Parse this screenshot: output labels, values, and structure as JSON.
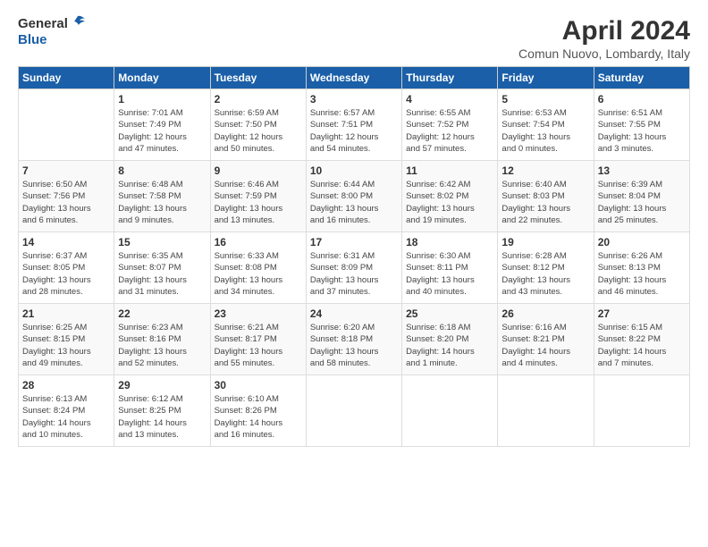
{
  "header": {
    "logo_general": "General",
    "logo_blue": "Blue",
    "title": "April 2024",
    "subtitle": "Comun Nuovo, Lombardy, Italy"
  },
  "days_of_week": [
    "Sunday",
    "Monday",
    "Tuesday",
    "Wednesday",
    "Thursday",
    "Friday",
    "Saturday"
  ],
  "weeks": [
    [
      {
        "day": "",
        "info": ""
      },
      {
        "day": "1",
        "info": "Sunrise: 7:01 AM\nSunset: 7:49 PM\nDaylight: 12 hours\nand 47 minutes."
      },
      {
        "day": "2",
        "info": "Sunrise: 6:59 AM\nSunset: 7:50 PM\nDaylight: 12 hours\nand 50 minutes."
      },
      {
        "day": "3",
        "info": "Sunrise: 6:57 AM\nSunset: 7:51 PM\nDaylight: 12 hours\nand 54 minutes."
      },
      {
        "day": "4",
        "info": "Sunrise: 6:55 AM\nSunset: 7:52 PM\nDaylight: 12 hours\nand 57 minutes."
      },
      {
        "day": "5",
        "info": "Sunrise: 6:53 AM\nSunset: 7:54 PM\nDaylight: 13 hours\nand 0 minutes."
      },
      {
        "day": "6",
        "info": "Sunrise: 6:51 AM\nSunset: 7:55 PM\nDaylight: 13 hours\nand 3 minutes."
      }
    ],
    [
      {
        "day": "7",
        "info": "Sunrise: 6:50 AM\nSunset: 7:56 PM\nDaylight: 13 hours\nand 6 minutes."
      },
      {
        "day": "8",
        "info": "Sunrise: 6:48 AM\nSunset: 7:58 PM\nDaylight: 13 hours\nand 9 minutes."
      },
      {
        "day": "9",
        "info": "Sunrise: 6:46 AM\nSunset: 7:59 PM\nDaylight: 13 hours\nand 13 minutes."
      },
      {
        "day": "10",
        "info": "Sunrise: 6:44 AM\nSunset: 8:00 PM\nDaylight: 13 hours\nand 16 minutes."
      },
      {
        "day": "11",
        "info": "Sunrise: 6:42 AM\nSunset: 8:02 PM\nDaylight: 13 hours\nand 19 minutes."
      },
      {
        "day": "12",
        "info": "Sunrise: 6:40 AM\nSunset: 8:03 PM\nDaylight: 13 hours\nand 22 minutes."
      },
      {
        "day": "13",
        "info": "Sunrise: 6:39 AM\nSunset: 8:04 PM\nDaylight: 13 hours\nand 25 minutes."
      }
    ],
    [
      {
        "day": "14",
        "info": "Sunrise: 6:37 AM\nSunset: 8:05 PM\nDaylight: 13 hours\nand 28 minutes."
      },
      {
        "day": "15",
        "info": "Sunrise: 6:35 AM\nSunset: 8:07 PM\nDaylight: 13 hours\nand 31 minutes."
      },
      {
        "day": "16",
        "info": "Sunrise: 6:33 AM\nSunset: 8:08 PM\nDaylight: 13 hours\nand 34 minutes."
      },
      {
        "day": "17",
        "info": "Sunrise: 6:31 AM\nSunset: 8:09 PM\nDaylight: 13 hours\nand 37 minutes."
      },
      {
        "day": "18",
        "info": "Sunrise: 6:30 AM\nSunset: 8:11 PM\nDaylight: 13 hours\nand 40 minutes."
      },
      {
        "day": "19",
        "info": "Sunrise: 6:28 AM\nSunset: 8:12 PM\nDaylight: 13 hours\nand 43 minutes."
      },
      {
        "day": "20",
        "info": "Sunrise: 6:26 AM\nSunset: 8:13 PM\nDaylight: 13 hours\nand 46 minutes."
      }
    ],
    [
      {
        "day": "21",
        "info": "Sunrise: 6:25 AM\nSunset: 8:15 PM\nDaylight: 13 hours\nand 49 minutes."
      },
      {
        "day": "22",
        "info": "Sunrise: 6:23 AM\nSunset: 8:16 PM\nDaylight: 13 hours\nand 52 minutes."
      },
      {
        "day": "23",
        "info": "Sunrise: 6:21 AM\nSunset: 8:17 PM\nDaylight: 13 hours\nand 55 minutes."
      },
      {
        "day": "24",
        "info": "Sunrise: 6:20 AM\nSunset: 8:18 PM\nDaylight: 13 hours\nand 58 minutes."
      },
      {
        "day": "25",
        "info": "Sunrise: 6:18 AM\nSunset: 8:20 PM\nDaylight: 14 hours\nand 1 minute."
      },
      {
        "day": "26",
        "info": "Sunrise: 6:16 AM\nSunset: 8:21 PM\nDaylight: 14 hours\nand 4 minutes."
      },
      {
        "day": "27",
        "info": "Sunrise: 6:15 AM\nSunset: 8:22 PM\nDaylight: 14 hours\nand 7 minutes."
      }
    ],
    [
      {
        "day": "28",
        "info": "Sunrise: 6:13 AM\nSunset: 8:24 PM\nDaylight: 14 hours\nand 10 minutes."
      },
      {
        "day": "29",
        "info": "Sunrise: 6:12 AM\nSunset: 8:25 PM\nDaylight: 14 hours\nand 13 minutes."
      },
      {
        "day": "30",
        "info": "Sunrise: 6:10 AM\nSunset: 8:26 PM\nDaylight: 14 hours\nand 16 minutes."
      },
      {
        "day": "",
        "info": ""
      },
      {
        "day": "",
        "info": ""
      },
      {
        "day": "",
        "info": ""
      },
      {
        "day": "",
        "info": ""
      }
    ]
  ]
}
